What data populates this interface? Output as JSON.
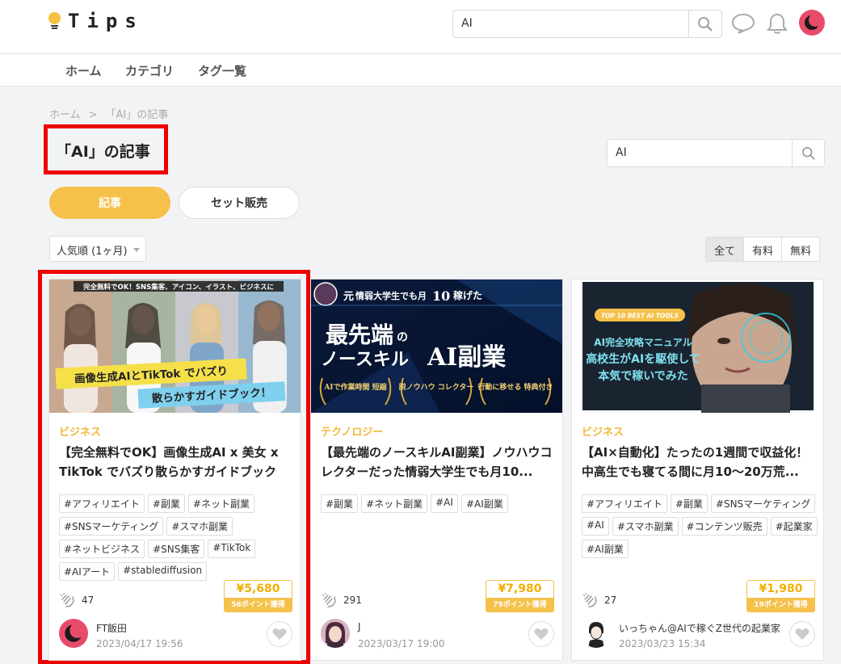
{
  "header": {
    "logo_text": "Tips",
    "search_value": "AI"
  },
  "nav": {
    "items": [
      "ホーム",
      "カテゴリ",
      "タグ一覧"
    ]
  },
  "breadcrumb": {
    "home": "ホーム",
    "sep": ">",
    "current": "「AI」の記事"
  },
  "page_title": "「AI」の記事",
  "content_search_value": "AI",
  "tabs": {
    "active": "記事",
    "inactive": "セット販売"
  },
  "sort": {
    "selected": "人気順 (1ヶ月)"
  },
  "filter": [
    "全て",
    "有料",
    "無料"
  ],
  "colors": {
    "accent": "#f5c14a",
    "highlight": "#e00000",
    "category": "#f0b93a"
  },
  "cards": [
    {
      "thumb": {
        "banner": "完全無料でOK！SNS集客、アイコン、イラスト、ビジネスに",
        "line1": "画像生成AIとTikTok でバズり",
        "line2": "散らかすガイドブック！"
      },
      "category": "ビジネス",
      "title": "【完全無料でOK】画像生成AI x 美女 x TikTok でバズり散らかすガイドブック",
      "tags": [
        "#アフィリエイト",
        "#副業",
        "#ネット副業",
        "#SNSマーケティング",
        "#スマホ副業",
        "#ネットビジネス",
        "#SNS集客",
        "#TikTok",
        "#AIアート",
        "#stablediffusion"
      ],
      "claps": "47",
      "price": "¥5,680",
      "points": "56ポイント獲得",
      "author": "FT飯田",
      "date": "2023/04/17 19:56"
    },
    {
      "thumb": {
        "line_top_a": "元",
        "line_top_b": "情弱大学生でも月",
        "line_top_c": "10",
        "line_top_d": "稼げた",
        "big1": "最先端",
        "big1_small": "の",
        "big2": "ノースキル",
        "big3": "AI副業",
        "badges": [
          "AIで作業時間 短縮",
          "脱ノウハウ コレクター",
          "行動に移せる 特典付き"
        ]
      },
      "category": "テクノロジー",
      "title": "【最先端のノースキルAI副業】ノウハウコレクターだった情弱大学生でも月10...",
      "tags": [
        "#副業",
        "#ネット副業",
        "#AI",
        "#AI副業"
      ],
      "claps": "291",
      "price": "¥7,980",
      "points": "79ポイント獲得",
      "author": "J",
      "date": "2023/03/17 19:00"
    },
    {
      "thumb": {
        "badge": "TOP 10 BEST AI TOOLS",
        "l1": "AI完全攻略マニュアル",
        "l2": "高校生がAIを駆使して",
        "l3": "本気で稼いでみた"
      },
      "category": "ビジネス",
      "title": "【AI×自動化】たったの1週間で収益化！中高生でも寝てる間に月10〜20万荒...",
      "tags": [
        "#アフィリエイト",
        "#副業",
        "#SNSマーケティング",
        "#AI",
        "#スマホ副業",
        "#コンテンツ販売",
        "#起業家",
        "#AI副業"
      ],
      "claps": "27",
      "price": "¥1,980",
      "points": "19ポイント獲得",
      "author": "いっちゃん@AIで稼ぐZ世代の起業家",
      "date": "2023/03/23 15:34"
    }
  ]
}
